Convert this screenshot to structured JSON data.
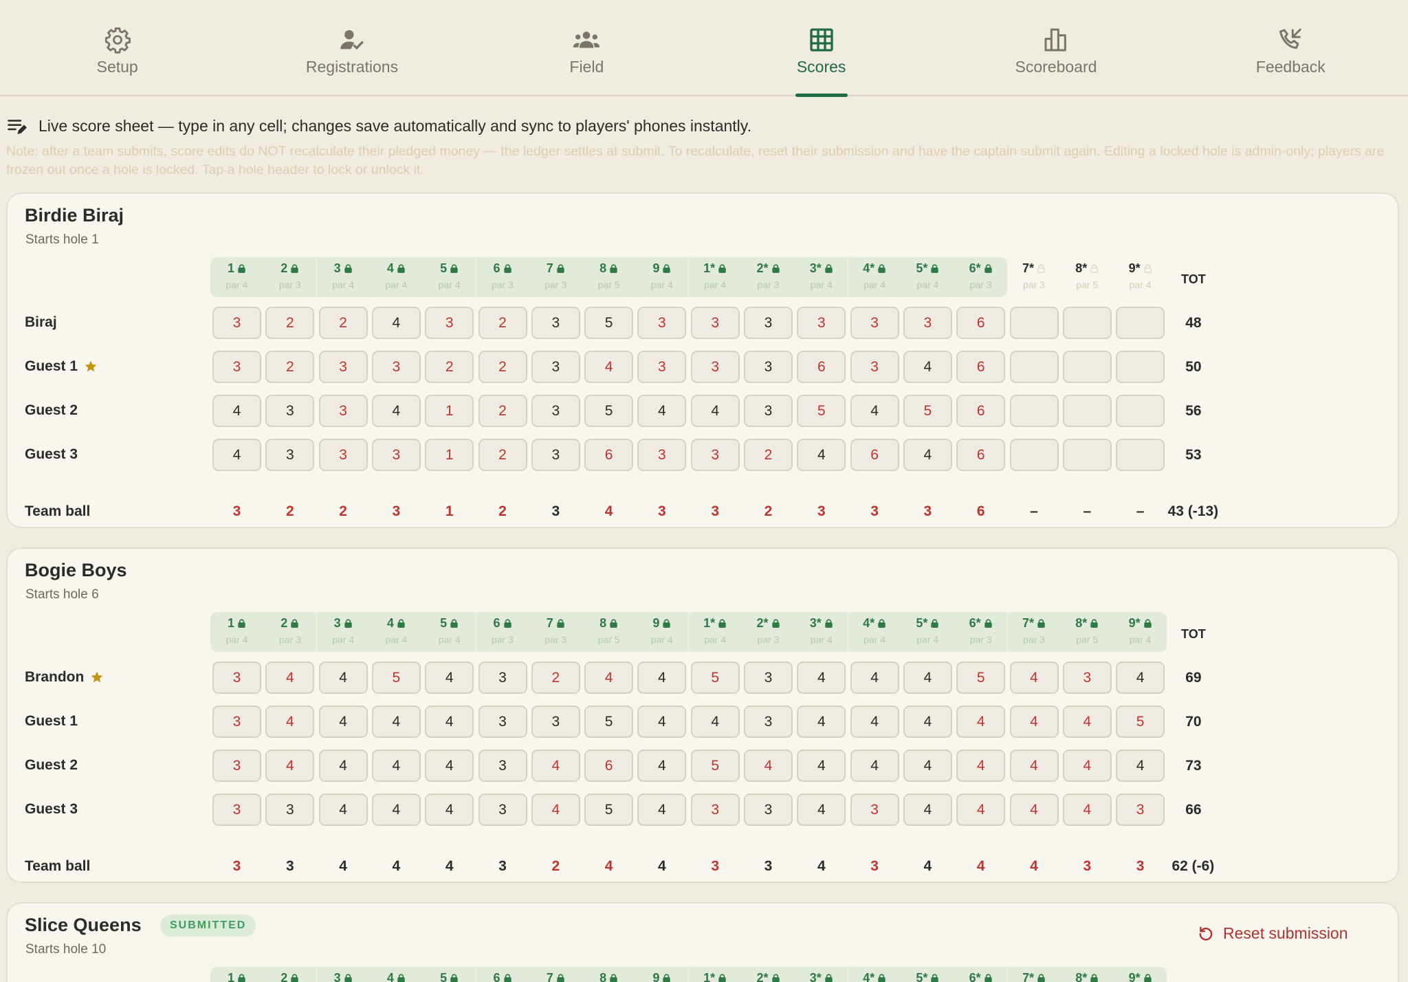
{
  "nav": {
    "tabs": [
      {
        "label": "Setup",
        "icon": "gear-icon",
        "active": false
      },
      {
        "label": "Registrations",
        "icon": "person-check-icon",
        "active": false
      },
      {
        "label": "Field",
        "icon": "group-icon",
        "active": false
      },
      {
        "label": "Scores",
        "icon": "grid-icon",
        "active": true
      },
      {
        "label": "Scoreboard",
        "icon": "bar-chart-icon",
        "active": false
      },
      {
        "label": "Feedback",
        "icon": "phone-callback-icon",
        "active": false
      }
    ]
  },
  "info": {
    "text": "Live score sheet — type in any cell; changes save automatically and sync to players' phones instantly.",
    "note": "Note: after a team submits, score edits do NOT recalculate their pledged money — the ledger settles at submit. To recalculate, reset their submission and have the captain submit again. Editing a locked hole is admin-only; players are frozen out once a hole is locked. Tap a hole header to lock or unlock it."
  },
  "colors": {
    "accent_green": "#1f6b46",
    "under_par_red": "#c4332b",
    "locked_bg": "#e2eadb",
    "captain_star": "#c2930f",
    "background": "#f1ece1"
  },
  "tot_label": "TOT",
  "team_ball_label": "Team ball",
  "holes": [
    {
      "label": "1",
      "par": "par 4"
    },
    {
      "label": "2",
      "par": "par 3"
    },
    {
      "label": "3",
      "par": "par 4"
    },
    {
      "label": "4",
      "par": "par 4"
    },
    {
      "label": "5",
      "par": "par 4"
    },
    {
      "label": "6",
      "par": "par 3"
    },
    {
      "label": "7",
      "par": "par 3"
    },
    {
      "label": "8",
      "par": "par 5"
    },
    {
      "label": "9",
      "par": "par 4"
    },
    {
      "label": "1*",
      "par": "par 4"
    },
    {
      "label": "2*",
      "par": "par 3"
    },
    {
      "label": "3*",
      "par": "par 4"
    },
    {
      "label": "4*",
      "par": "par 4"
    },
    {
      "label": "5*",
      "par": "par 4"
    },
    {
      "label": "6*",
      "par": "par 3"
    },
    {
      "label": "7*",
      "par": "par 3"
    },
    {
      "label": "8*",
      "par": "par 5"
    },
    {
      "label": "9*",
      "par": "par 4"
    }
  ],
  "teams": [
    {
      "name": "Birdie Biraj",
      "start": "Starts hole 1",
      "badge": "",
      "reset_label": "",
      "locked": [
        true,
        true,
        true,
        true,
        true,
        true,
        true,
        true,
        true,
        true,
        true,
        true,
        true,
        true,
        true,
        false,
        false,
        false
      ],
      "players": [
        {
          "name": "Biraj",
          "captain": false,
          "scores": [
            "3",
            "2",
            "2",
            "4",
            "3",
            "2",
            "3",
            "5",
            "3",
            "3",
            "3",
            "3",
            "3",
            "3",
            "6",
            "",
            "",
            ""
          ],
          "under": [
            true,
            true,
            true,
            false,
            true,
            true,
            false,
            false,
            true,
            true,
            false,
            true,
            true,
            true,
            true,
            false,
            false,
            false
          ],
          "total": "48"
        },
        {
          "name": "Guest 1",
          "captain": true,
          "scores": [
            "3",
            "2",
            "3",
            "3",
            "2",
            "2",
            "3",
            "4",
            "3",
            "3",
            "3",
            "6",
            "3",
            "4",
            "6",
            "",
            "",
            ""
          ],
          "under": [
            true,
            true,
            true,
            true,
            true,
            true,
            false,
            true,
            true,
            true,
            false,
            true,
            true,
            false,
            true,
            false,
            false,
            false
          ],
          "total": "50"
        },
        {
          "name": "Guest 2",
          "captain": false,
          "scores": [
            "4",
            "3",
            "3",
            "4",
            "1",
            "2",
            "3",
            "5",
            "4",
            "4",
            "3",
            "5",
            "4",
            "5",
            "6",
            "",
            "",
            ""
          ],
          "under": [
            false,
            false,
            true,
            false,
            true,
            true,
            false,
            false,
            false,
            false,
            false,
            true,
            false,
            true,
            true,
            false,
            false,
            false
          ],
          "total": "56"
        },
        {
          "name": "Guest 3",
          "captain": false,
          "scores": [
            "4",
            "3",
            "3",
            "3",
            "1",
            "2",
            "3",
            "6",
            "3",
            "3",
            "2",
            "4",
            "6",
            "4",
            "6",
            "",
            "",
            ""
          ],
          "under": [
            false,
            false,
            true,
            true,
            true,
            true,
            false,
            true,
            true,
            true,
            true,
            false,
            true,
            false,
            true,
            false,
            false,
            false
          ],
          "total": "53"
        }
      ],
      "team_ball": [
        "3",
        "2",
        "2",
        "3",
        "1",
        "2",
        "3",
        "4",
        "3",
        "3",
        "2",
        "3",
        "3",
        "3",
        "6",
        "–",
        "–",
        "–"
      ],
      "team_ball_under": [
        true,
        true,
        true,
        true,
        true,
        true,
        false,
        true,
        true,
        true,
        true,
        true,
        true,
        true,
        true,
        false,
        false,
        false
      ],
      "team_total": "43 (-13)"
    },
    {
      "name": "Bogie Boys",
      "start": "Starts hole 6",
      "badge": "",
      "reset_label": "",
      "locked": [
        true,
        true,
        true,
        true,
        true,
        true,
        true,
        true,
        true,
        true,
        true,
        true,
        true,
        true,
        true,
        true,
        true,
        true
      ],
      "players": [
        {
          "name": "Brandon",
          "captain": true,
          "scores": [
            "3",
            "4",
            "4",
            "5",
            "4",
            "3",
            "2",
            "4",
            "4",
            "5",
            "3",
            "4",
            "4",
            "4",
            "5",
            "4",
            "3",
            "4"
          ],
          "under": [
            true,
            true,
            false,
            true,
            false,
            false,
            true,
            true,
            false,
            true,
            false,
            false,
            false,
            false,
            true,
            true,
            true,
            false
          ],
          "total": "69"
        },
        {
          "name": "Guest 1",
          "captain": false,
          "scores": [
            "3",
            "4",
            "4",
            "4",
            "4",
            "3",
            "3",
            "5",
            "4",
            "4",
            "3",
            "4",
            "4",
            "4",
            "4",
            "4",
            "4",
            "5"
          ],
          "under": [
            true,
            true,
            false,
            false,
            false,
            false,
            false,
            false,
            false,
            false,
            false,
            false,
            false,
            false,
            true,
            true,
            true,
            true
          ],
          "total": "70"
        },
        {
          "name": "Guest 2",
          "captain": false,
          "scores": [
            "3",
            "4",
            "4",
            "4",
            "4",
            "3",
            "4",
            "6",
            "4",
            "5",
            "4",
            "4",
            "4",
            "4",
            "4",
            "4",
            "4",
            "4"
          ],
          "under": [
            true,
            true,
            false,
            false,
            false,
            false,
            true,
            true,
            false,
            true,
            true,
            false,
            false,
            false,
            true,
            true,
            true,
            false
          ],
          "total": "73"
        },
        {
          "name": "Guest 3",
          "captain": false,
          "scores": [
            "3",
            "3",
            "4",
            "4",
            "4",
            "3",
            "4",
            "5",
            "4",
            "3",
            "3",
            "4",
            "3",
            "4",
            "4",
            "4",
            "4",
            "3"
          ],
          "under": [
            true,
            false,
            false,
            false,
            false,
            false,
            true,
            false,
            false,
            true,
            false,
            false,
            true,
            false,
            true,
            true,
            true,
            true
          ],
          "total": "66"
        }
      ],
      "team_ball": [
        "3",
        "3",
        "4",
        "4",
        "4",
        "3",
        "2",
        "4",
        "4",
        "3",
        "3",
        "4",
        "3",
        "4",
        "4",
        "4",
        "3",
        "3"
      ],
      "team_ball_under": [
        true,
        false,
        false,
        false,
        false,
        false,
        true,
        true,
        false,
        true,
        false,
        false,
        true,
        false,
        true,
        true,
        true,
        true
      ],
      "team_total": "62 (-6)"
    },
    {
      "name": "Slice Queens",
      "start": "Starts hole 10",
      "badge": "SUBMITTED",
      "reset_label": "Reset submission",
      "locked": [
        true,
        true,
        true,
        true,
        true,
        true,
        true,
        true,
        true,
        true,
        true,
        true,
        true,
        true,
        true,
        true,
        true,
        true
      ],
      "players": [],
      "team_ball": [],
      "team_ball_under": [],
      "team_total": ""
    }
  ]
}
